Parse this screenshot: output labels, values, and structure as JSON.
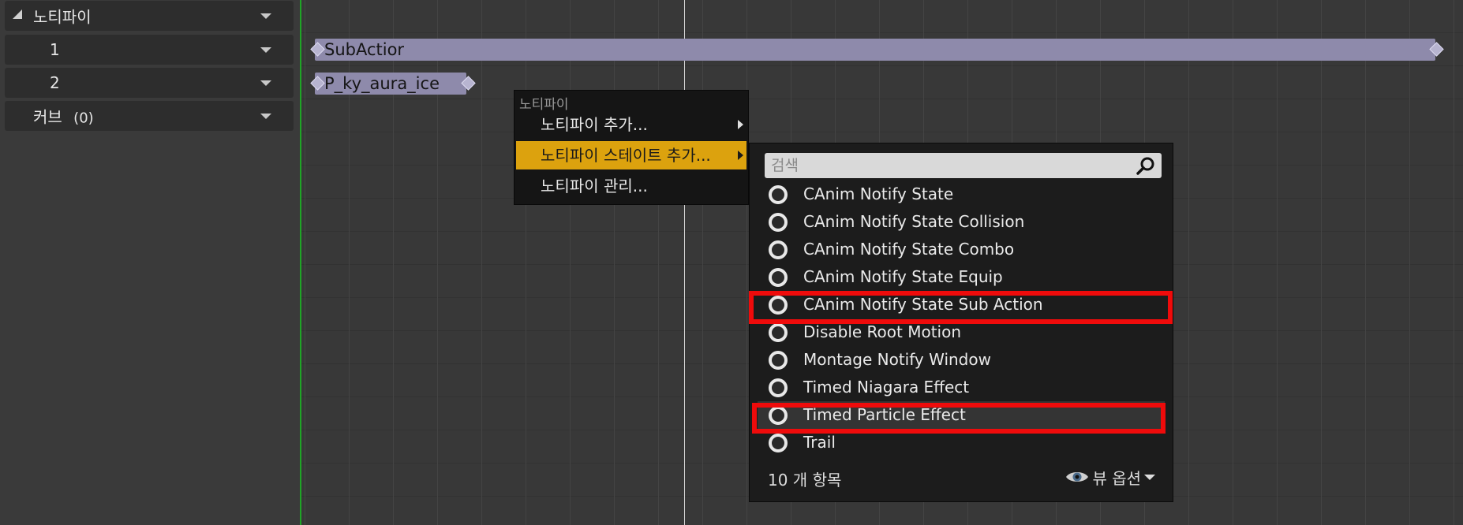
{
  "tracks": {
    "header_label": "노티파이",
    "rows": [
      {
        "label": "1"
      },
      {
        "label": "2"
      }
    ],
    "curves_label": "커브",
    "curves_count": "(0)"
  },
  "timeline": {
    "notify_1_label": "SubActior",
    "notify_2_label": "P_ky_aura_ice"
  },
  "context_menu": {
    "header": "노티파이",
    "items": [
      {
        "label": "노티파이 추가..."
      },
      {
        "label": "노티파이 스테이트 추가..."
      },
      {
        "label": "노티파이 관리..."
      }
    ]
  },
  "submenu": {
    "search_placeholder": "검색",
    "items": [
      {
        "label": "CAnim Notify State"
      },
      {
        "label": "CAnim Notify State Collision"
      },
      {
        "label": "CAnim Notify State Combo"
      },
      {
        "label": "CAnim Notify State Equip"
      },
      {
        "label": "CAnim Notify State Sub Action"
      },
      {
        "label": "Disable Root Motion"
      },
      {
        "label": "Montage Notify Window"
      },
      {
        "label": "Timed Niagara Effect"
      },
      {
        "label": "Timed Particle Effect"
      },
      {
        "label": "Trail"
      }
    ],
    "item_count": "10 개 항목",
    "view_options_label": "뷰 옵션"
  },
  "colors": {
    "highlight": "#dca20e",
    "notify_bar": "#8e8aab",
    "annotation_red": "#ef0b0b",
    "timeline_green": "#1fa526"
  }
}
